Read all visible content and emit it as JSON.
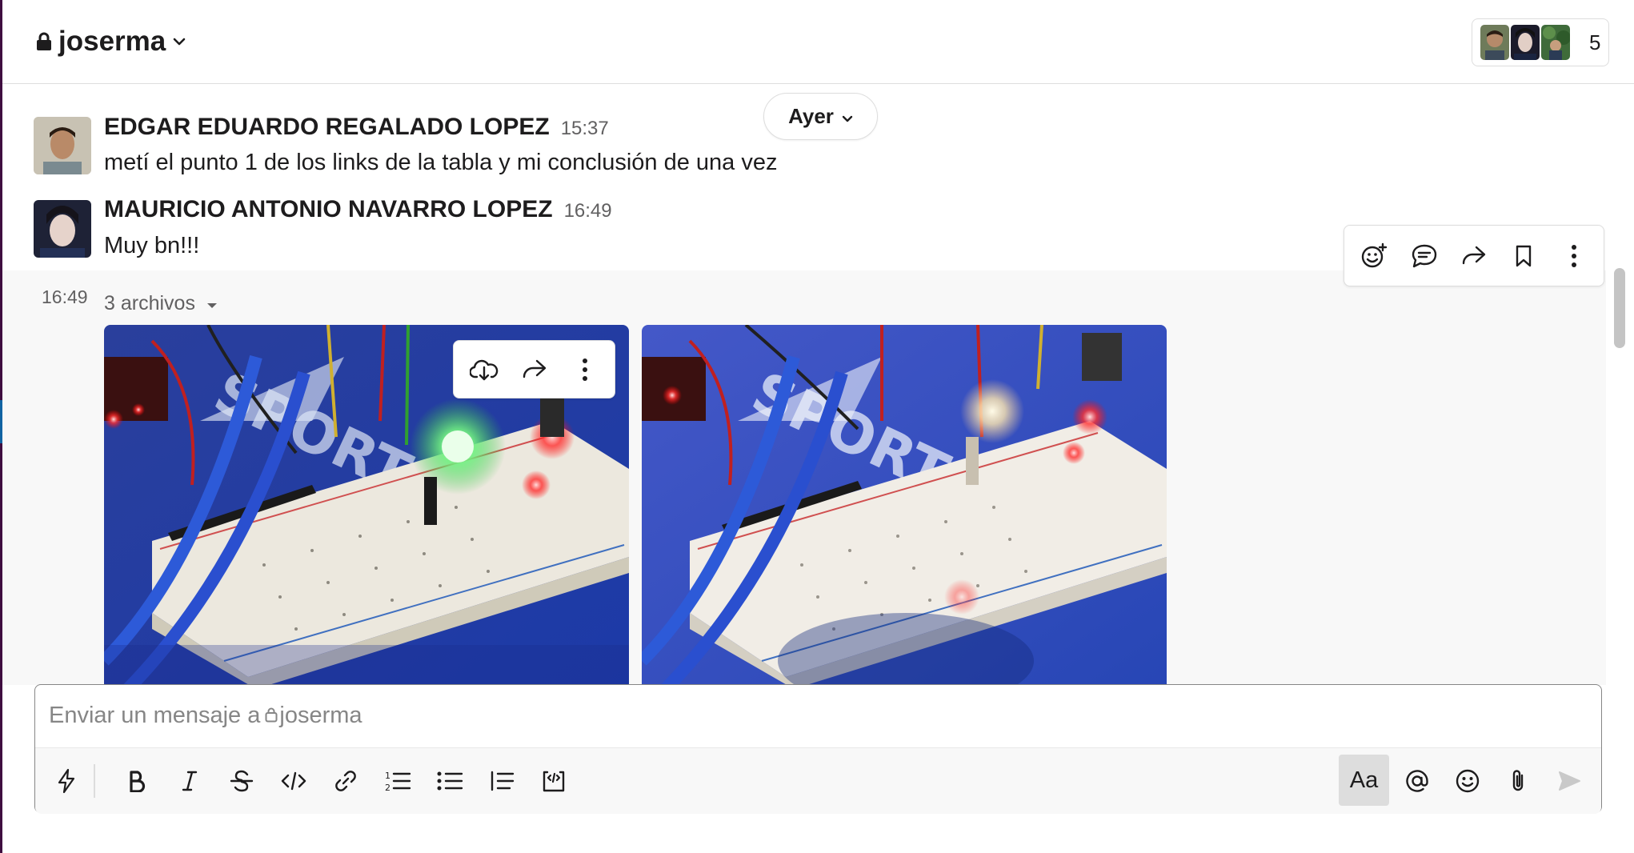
{
  "channel": {
    "name": "joserma",
    "member_count": "5"
  },
  "date_divider": {
    "label": "Ayer"
  },
  "messages": [
    {
      "author": "EDGAR EDUARDO REGALADO LOPEZ",
      "time": "15:37",
      "text": "metí el punto 1 de los links de la tabla y mi conclusión de una vez"
    },
    {
      "author": "MAURICIO ANTONIO NAVARRO LOPEZ",
      "time": "16:49",
      "text": "Muy bn!!!"
    }
  ],
  "files_message": {
    "time": "16:49",
    "label": "3 archivos"
  },
  "composer": {
    "placeholder_prefix": "Enviar un mensaje a",
    "placeholder_channel": "joserma",
    "placeholder_full": "Enviar un mensaje a joserma",
    "format_toggle_label": "Aa"
  },
  "icons": {
    "message_actions": [
      "add-reaction-icon",
      "reply-in-thread-icon",
      "share-icon",
      "bookmark-icon",
      "more-actions-icon"
    ],
    "file_actions": [
      "download-icon",
      "share-icon",
      "more-actions-icon"
    ],
    "toolbar": [
      "shortcuts-icon",
      "bold-icon",
      "italic-icon",
      "strikethrough-icon",
      "code-icon",
      "link-icon",
      "ordered-list-icon",
      "bulleted-list-icon",
      "blockquote-icon",
      "code-block-icon",
      "mention-icon",
      "emoji-icon",
      "attach-icon",
      "send-icon"
    ]
  },
  "colors": {
    "sidebar_edge": "#3f0e40",
    "text_primary": "#1d1c1d",
    "text_secondary": "#616061",
    "border": "#dddddd"
  }
}
